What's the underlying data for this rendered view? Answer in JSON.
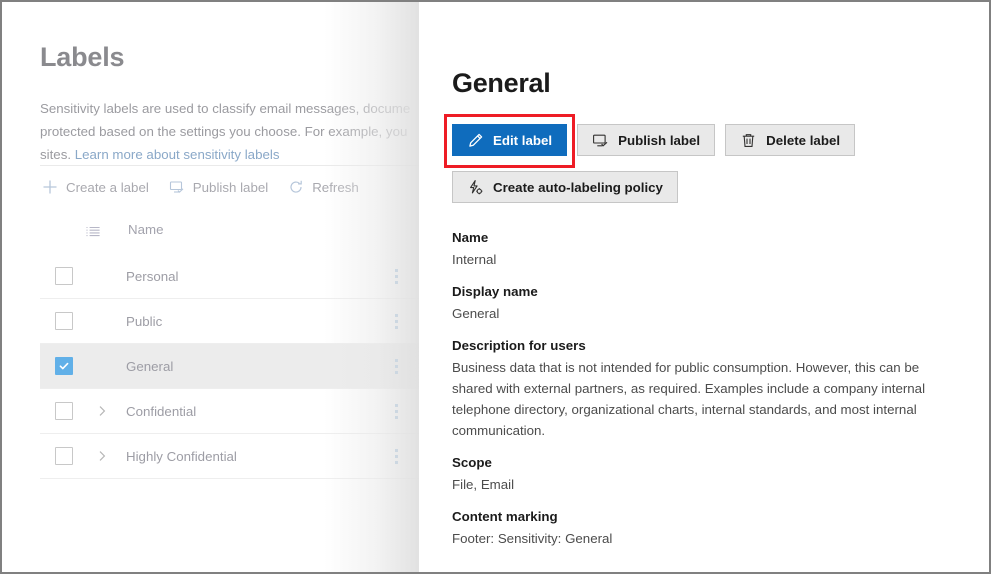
{
  "left": {
    "title": "Labels",
    "description": "Sensitivity labels are used to classify email messages, docume\nprotected based on the settings you choose. For example, you\nsites. ",
    "description_link": "Learn more about sensitivity labels",
    "commands": [
      {
        "label": "Create a label",
        "icon": "plus-icon"
      },
      {
        "label": "Publish label",
        "icon": "monitor-check-icon"
      },
      {
        "label": "Refresh",
        "icon": "refresh-icon"
      }
    ],
    "table": {
      "header_icon": "list-view-icon",
      "columns": [
        "Name"
      ],
      "rows": [
        {
          "name": "Personal",
          "checked": false,
          "expandable": false
        },
        {
          "name": "Public",
          "checked": false,
          "expandable": false
        },
        {
          "name": "General",
          "checked": true,
          "expandable": false
        },
        {
          "name": "Confidential",
          "checked": false,
          "expandable": true
        },
        {
          "name": "Highly Confidential",
          "checked": false,
          "expandable": true
        }
      ]
    }
  },
  "panel": {
    "title": "General",
    "buttons": [
      {
        "label": "Edit label",
        "icon": "pencil-icon",
        "primary": true
      },
      {
        "label": "Publish label",
        "icon": "monitor-check-icon",
        "primary": false
      },
      {
        "label": "Delete label",
        "icon": "trash-icon",
        "primary": false
      }
    ],
    "secondary_buttons": [
      {
        "label": "Create auto-labeling policy",
        "icon": "lightning-gear-icon",
        "primary": false
      }
    ],
    "fields": [
      {
        "label": "Name",
        "value": "Internal"
      },
      {
        "label": "Display name",
        "value": "General"
      },
      {
        "label": "Description for users",
        "value": "Business data that is not intended for public consumption. However, this can be shared with external partners, as required. Examples include a company internal telephone directory, organizational charts, internal standards, and most internal communication."
      },
      {
        "label": "Scope",
        "value": "File, Email"
      },
      {
        "label": "Content marking",
        "value": "Footer: Sensitivity: General"
      }
    ]
  },
  "colors": {
    "primary_button": "#0f6cbd",
    "highlight_border": "#ee1c25",
    "checkbox_checked": "#61b0e8",
    "row_selected": "#ececec"
  }
}
